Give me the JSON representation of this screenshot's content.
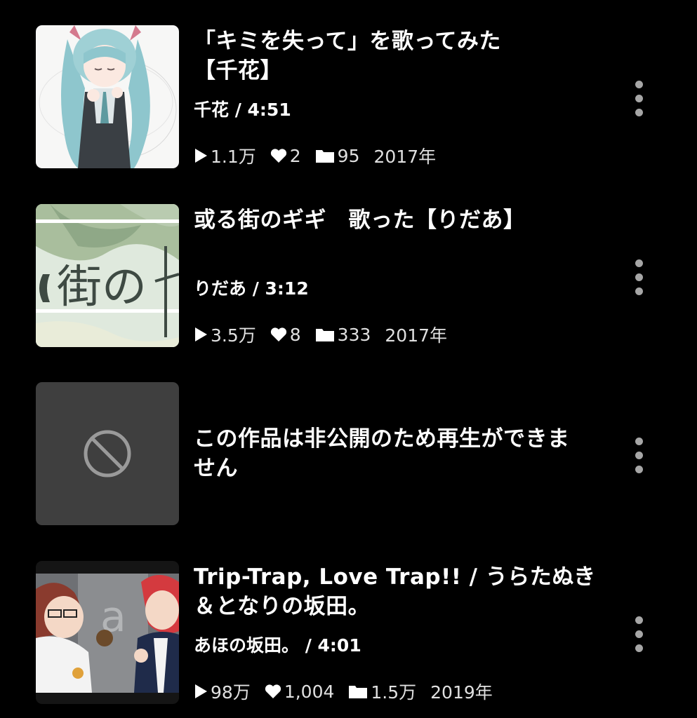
{
  "items": [
    {
      "title": "「キミを失って」を歌ってみた【千花】",
      "title_line1": "「キミを失って」を歌ってみた",
      "title_line2": "【千花】",
      "meta": "千花 / 4:51",
      "plays": "1.1万",
      "likes": "2",
      "mylists": "95",
      "year": "2017年"
    },
    {
      "title": "或る街のギギ　歌った【りだあ】",
      "meta": "りだあ / 3:12",
      "plays": "3.5万",
      "likes": "8",
      "mylists": "333",
      "year": "2017年"
    },
    {
      "title_line1": "この作品は非公開のため再生ができま",
      "title_line2": "せん"
    },
    {
      "title_line1": "Trip-Trap, Love Trap!! / うらたぬき",
      "title_line2": "＆となりの坂田。",
      "meta": "あほの坂田。 / 4:01",
      "plays": "98万",
      "likes": "1,004",
      "mylists": "1.5万",
      "year": "2019年"
    }
  ],
  "thumb_text": {
    "item2": "街の"
  },
  "icons": {
    "play": "play-icon",
    "heart": "heart-icon",
    "folder": "folder-icon",
    "more": "more-vertical-icon",
    "blocked": "blocked-icon"
  },
  "colors": {
    "background": "#000000",
    "text": "#ffffff",
    "secondary": "#e0e0e0",
    "dots": "#a6a6a6",
    "private_thumb": "#3f3f3f"
  }
}
